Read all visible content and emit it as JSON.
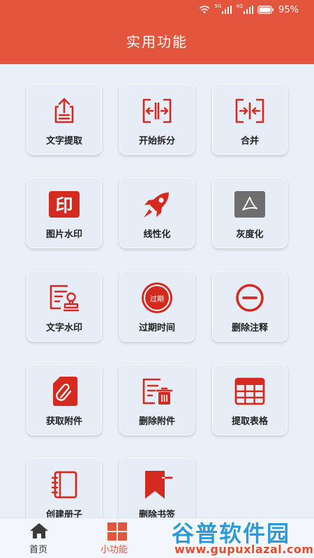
{
  "status_bar": {
    "battery": "95%",
    "net1": "5G",
    "net2": "4G"
  },
  "header": {
    "title": "实用功能"
  },
  "features": [
    {
      "label": "文字提取",
      "icon": "text-extract-icon"
    },
    {
      "label": "开始拆分",
      "icon": "split-icon"
    },
    {
      "label": "合并",
      "icon": "merge-icon"
    },
    {
      "label": "图片水印",
      "icon": "image-watermark-icon"
    },
    {
      "label": "线性化",
      "icon": "rocket-icon"
    },
    {
      "label": "灰度化",
      "icon": "pdf-grayscale-icon"
    },
    {
      "label": "文字水印",
      "icon": "text-watermark-icon"
    },
    {
      "label": "过期时间",
      "icon": "expiry-stamp-icon",
      "icon_text": "过期"
    },
    {
      "label": "删除注释",
      "icon": "remove-annotation-icon"
    },
    {
      "label": "获取附件",
      "icon": "attachment-icon"
    },
    {
      "label": "删除附件",
      "icon": "delete-attachment-icon"
    },
    {
      "label": "提取表格",
      "icon": "table-icon"
    },
    {
      "label": "创建册子",
      "icon": "booklet-icon"
    },
    {
      "label": "删除书签",
      "icon": "delete-bookmark-icon"
    }
  ],
  "image_watermark_glyph": "印",
  "bottom_nav": [
    {
      "label": "首页",
      "icon": "home-icon"
    },
    {
      "label": "小功能",
      "icon": "grid-icon"
    }
  ],
  "watermark": {
    "line1": "谷普软件园",
    "line2": "www.gupuxlazal.com"
  },
  "colors": {
    "accent": "#e4553e",
    "icon_red": "#d42a1f",
    "background": "#eaf0f8"
  }
}
